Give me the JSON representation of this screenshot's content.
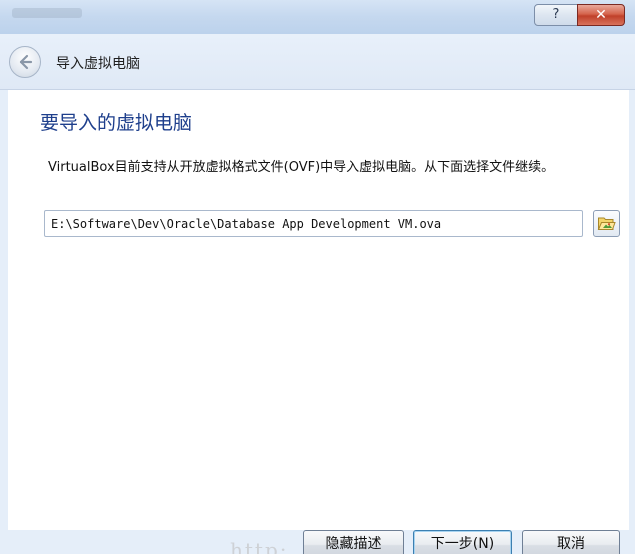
{
  "titlebar": {
    "help_label": "?",
    "close_label": "✕"
  },
  "nav": {
    "title": "导入虚拟电脑"
  },
  "content": {
    "heading": "要导入的虚拟电脑",
    "description": "VirtualBox目前支持从开放虚拟格式文件(OVF)中导入虚拟电脑。从下面选择文件继续。",
    "file_path": "E:\\Software\\Dev\\Oracle\\Database App Development VM.ova"
  },
  "buttons": {
    "hide_description": "隐藏描述",
    "next": "下一步(N)",
    "cancel": "取消"
  },
  "watermark": "http:"
}
